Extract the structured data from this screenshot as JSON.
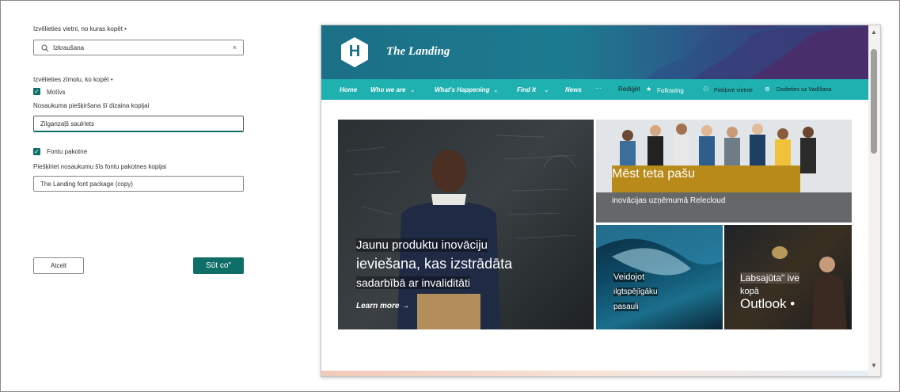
{
  "form": {
    "location_label": "Izvēlieties vietni, no kuras kopēt •",
    "search_value": "Izkraušana",
    "elements_label": "Izvēlieties zīmolu, ko kopēt •",
    "theme_label": "Motīvs",
    "theme_name_label": "Nosaukuma piešķiršana šī dizaina kopijai",
    "theme_name_value": "Zilganzaļš saulriets",
    "font_label": "Fontu pakotne",
    "font_name_label": "Piešķiriet nosaukumu šīs fontu pakotnes kopijai",
    "font_name_value": "The Landing font package (copy)",
    "cancel_label": "Atcelt",
    "send_label": "Sūt co\""
  },
  "preview": {
    "site_logo_letter": "H",
    "site_title": "The Landing",
    "nav": [
      "Home",
      "Who we are",
      "What's Happening",
      "Find It",
      "News",
      "···",
      "Rediģēt"
    ],
    "nav_actions": {
      "following": "Following",
      "share": "Piekļuve vietnei",
      "go": "Dodieties uz Vadīšana"
    },
    "hero": {
      "line1": "Jaunu produktu inovāciju",
      "line2": "ieviešana, kas izstrādāta",
      "line3": "sadarbībā ar invaliditāti",
      "link": "Learn more"
    },
    "tile_team": {
      "title": "Mēst teta pašu",
      "subtitle": "inovācijas uzņēmumā Relecloud"
    },
    "tile_wave": {
      "line1": "Veidojot",
      "line2": "ilgtspējīgāku",
      "line3": "pasauli"
    },
    "tile_outlook": {
      "line1": "Labsajūta\" ive",
      "line2": "kopā",
      "line3": "Outlook •"
    }
  },
  "colors": {
    "accent": "#0f6e68",
    "nav": "#1fb0b0",
    "gold": "#b88a1a"
  }
}
